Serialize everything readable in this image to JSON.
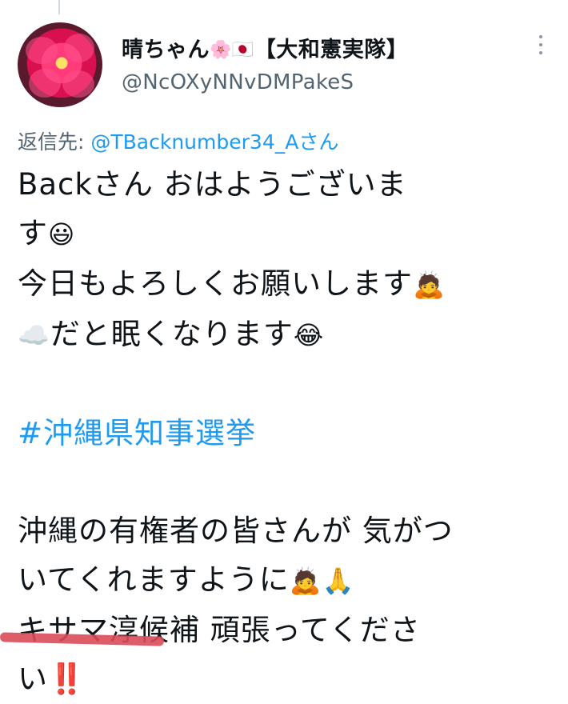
{
  "user": {
    "display_name": "晴ちゃん",
    "flower_emoji": "🌸",
    "flag_emoji": "🇯🇵",
    "group_tag": "【大和憲実隊】",
    "handle": "@NcOXyNNvDMPakeS"
  },
  "reply_to": {
    "prefix": "返信先: ",
    "mention": "@TBacknumber34_Aさん"
  },
  "tweet": {
    "line1": "Backさん おはようございま",
    "line2_text": "す",
    "line2_emoji": "😃",
    "line3_text": "今日もよろしくお願いします",
    "line3_emoji": "🙇",
    "line4_emoji": "☁️",
    "line4_text": "だと眠くなります",
    "line4_emoji2": "😂",
    "hashtag": "#沖縄県知事選挙",
    "line6": "沖縄の有権者の皆さんが 気がつ",
    "line7_text": "いてくれますように",
    "line7_emoji1": "🙇",
    "line7_emoji2": "🙏",
    "line8": "キサマ淳候補 頑張ってくださ",
    "line9_text": "い",
    "line9_mark": "‼️"
  },
  "colors": {
    "accent": "#1d9bf0",
    "secondary_text": "#536471",
    "exclaim": "#e0243c",
    "scribble": "#d94b5a"
  },
  "icons": {
    "more": "more-vertical-icon"
  }
}
